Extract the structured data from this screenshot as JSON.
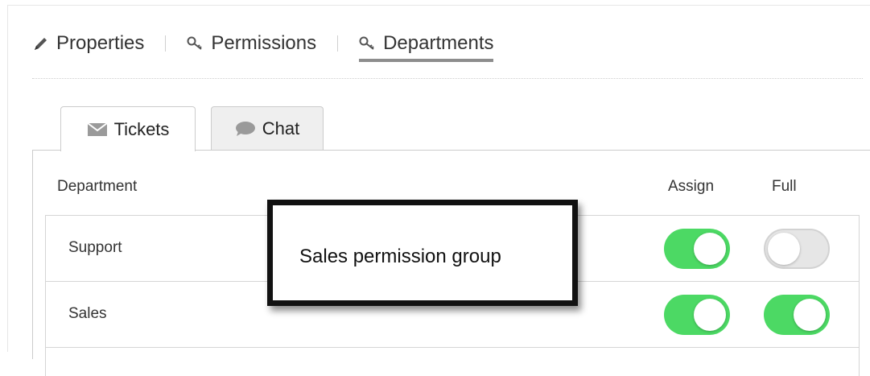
{
  "nav": {
    "items": [
      {
        "label": "Properties",
        "icon": "pencil-icon"
      },
      {
        "label": "Permissions",
        "icon": "key-icon"
      },
      {
        "label": "Departments",
        "icon": "key-icon",
        "active": true
      }
    ]
  },
  "tabs": [
    {
      "label": "Tickets",
      "icon": "envelope-icon",
      "active": true
    },
    {
      "label": "Chat",
      "icon": "chat-bubble-icon"
    }
  ],
  "table": {
    "headers": {
      "department": "Department",
      "assign": "Assign",
      "full": "Full"
    },
    "rows": [
      {
        "name": "Support",
        "assign": true,
        "full": false
      },
      {
        "name": "Sales",
        "assign": true,
        "full": true
      }
    ]
  },
  "callout": {
    "text": "Sales permission group"
  },
  "colors": {
    "toggle_on": "#4cd964",
    "toggle_off": "#e6e6e6",
    "active_underline": "#8d8d8d"
  }
}
